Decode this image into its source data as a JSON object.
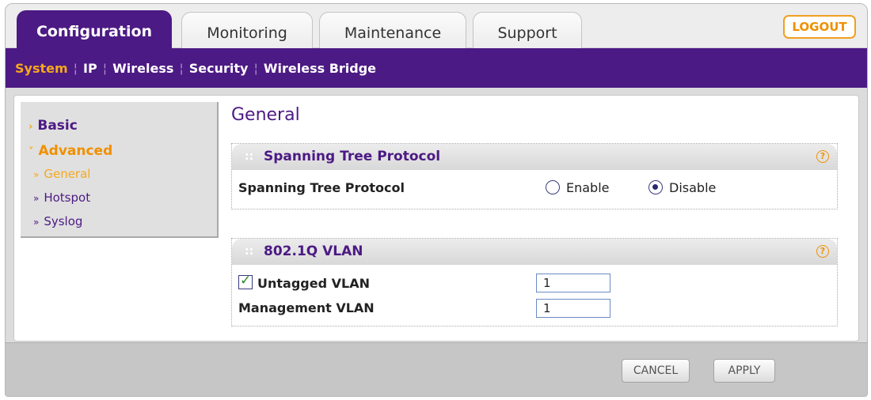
{
  "tabs": [
    {
      "label": "Configuration",
      "active": true
    },
    {
      "label": "Monitoring",
      "active": false
    },
    {
      "label": "Maintenance",
      "active": false
    },
    {
      "label": "Support",
      "active": false
    }
  ],
  "logout_label": "LOGOUT",
  "subnav": [
    {
      "label": "System",
      "active": true
    },
    {
      "label": "IP",
      "active": false
    },
    {
      "label": "Wireless",
      "active": false
    },
    {
      "label": "Security",
      "active": false
    },
    {
      "label": "Wireless Bridge",
      "active": false
    }
  ],
  "sidebar": {
    "basic": "Basic",
    "advanced": "Advanced",
    "sub_items": [
      {
        "label": "General",
        "active": true
      },
      {
        "label": "Hotspot",
        "active": false
      },
      {
        "label": "Syslog",
        "active": false
      }
    ]
  },
  "page_title": "General",
  "stp": {
    "section_title": "Spanning Tree Protocol",
    "row_label": "Spanning Tree Protocol",
    "enable_label": "Enable",
    "disable_label": "Disable",
    "selected": "Disable"
  },
  "vlan": {
    "section_title": "802.1Q VLAN",
    "untagged_label": "Untagged VLAN",
    "untagged_checked": true,
    "untagged_value": "1",
    "management_label": "Management VLAN",
    "management_value": "1"
  },
  "buttons": {
    "cancel": "CANCEL",
    "apply": "APPLY"
  },
  "colors": {
    "brand_purple": "#4c1a84",
    "accent_orange": "#f7a81b"
  }
}
